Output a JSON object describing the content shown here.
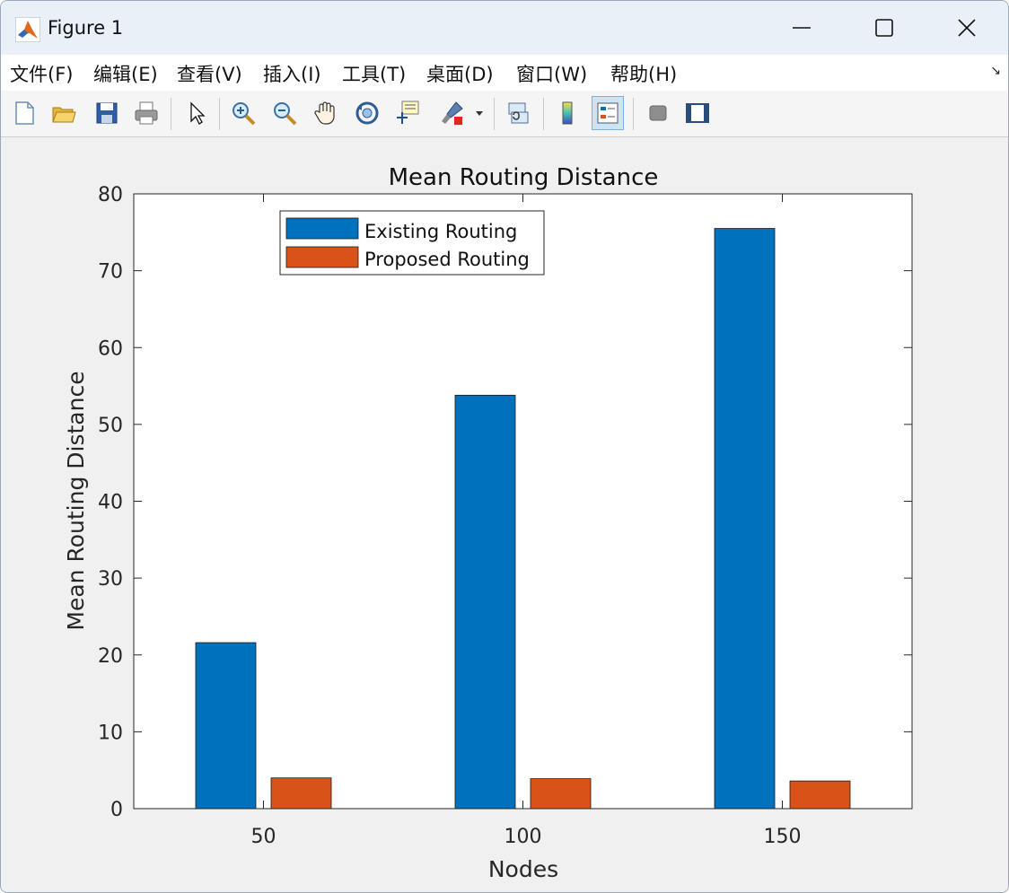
{
  "window": {
    "title": "Figure 1",
    "menu": [
      "文件(F)",
      "编辑(E)",
      "查看(V)",
      "插入(I)",
      "工具(T)",
      "桌面(D)",
      "窗口(W)",
      "帮助(H)"
    ]
  },
  "toolbar": {
    "icons": [
      "new-figure-icon",
      "open-file-icon",
      "save-icon",
      "print-icon",
      "select-arrow-icon",
      "zoom-in-icon",
      "zoom-out-icon",
      "pan-hand-icon",
      "rotate-3d-icon",
      "data-cursor-icon",
      "brush-icon",
      "link-plot-icon",
      "colorbar-icon",
      "legend-icon",
      "hide-plot-tools-icon",
      "show-plot-tools-icon"
    ]
  },
  "colors": {
    "existing": "#0072bd",
    "proposed": "#d95319",
    "axis": "#262626"
  },
  "chart_data": {
    "type": "bar",
    "title": "Mean Routing Distance",
    "xlabel": "Nodes",
    "ylabel": "Mean Routing Distance",
    "categories": [
      "50",
      "100",
      "150"
    ],
    "series": [
      {
        "name": "Existing Routing",
        "values": [
          21.6,
          53.8,
          75.5
        ]
      },
      {
        "name": "Proposed Routing",
        "values": [
          4.0,
          3.9,
          3.6
        ]
      }
    ],
    "ylim": [
      0,
      80
    ],
    "yticks": [
      0,
      10,
      20,
      30,
      40,
      50,
      60,
      70,
      80
    ],
    "legend_position": "top-left",
    "grid": false
  }
}
